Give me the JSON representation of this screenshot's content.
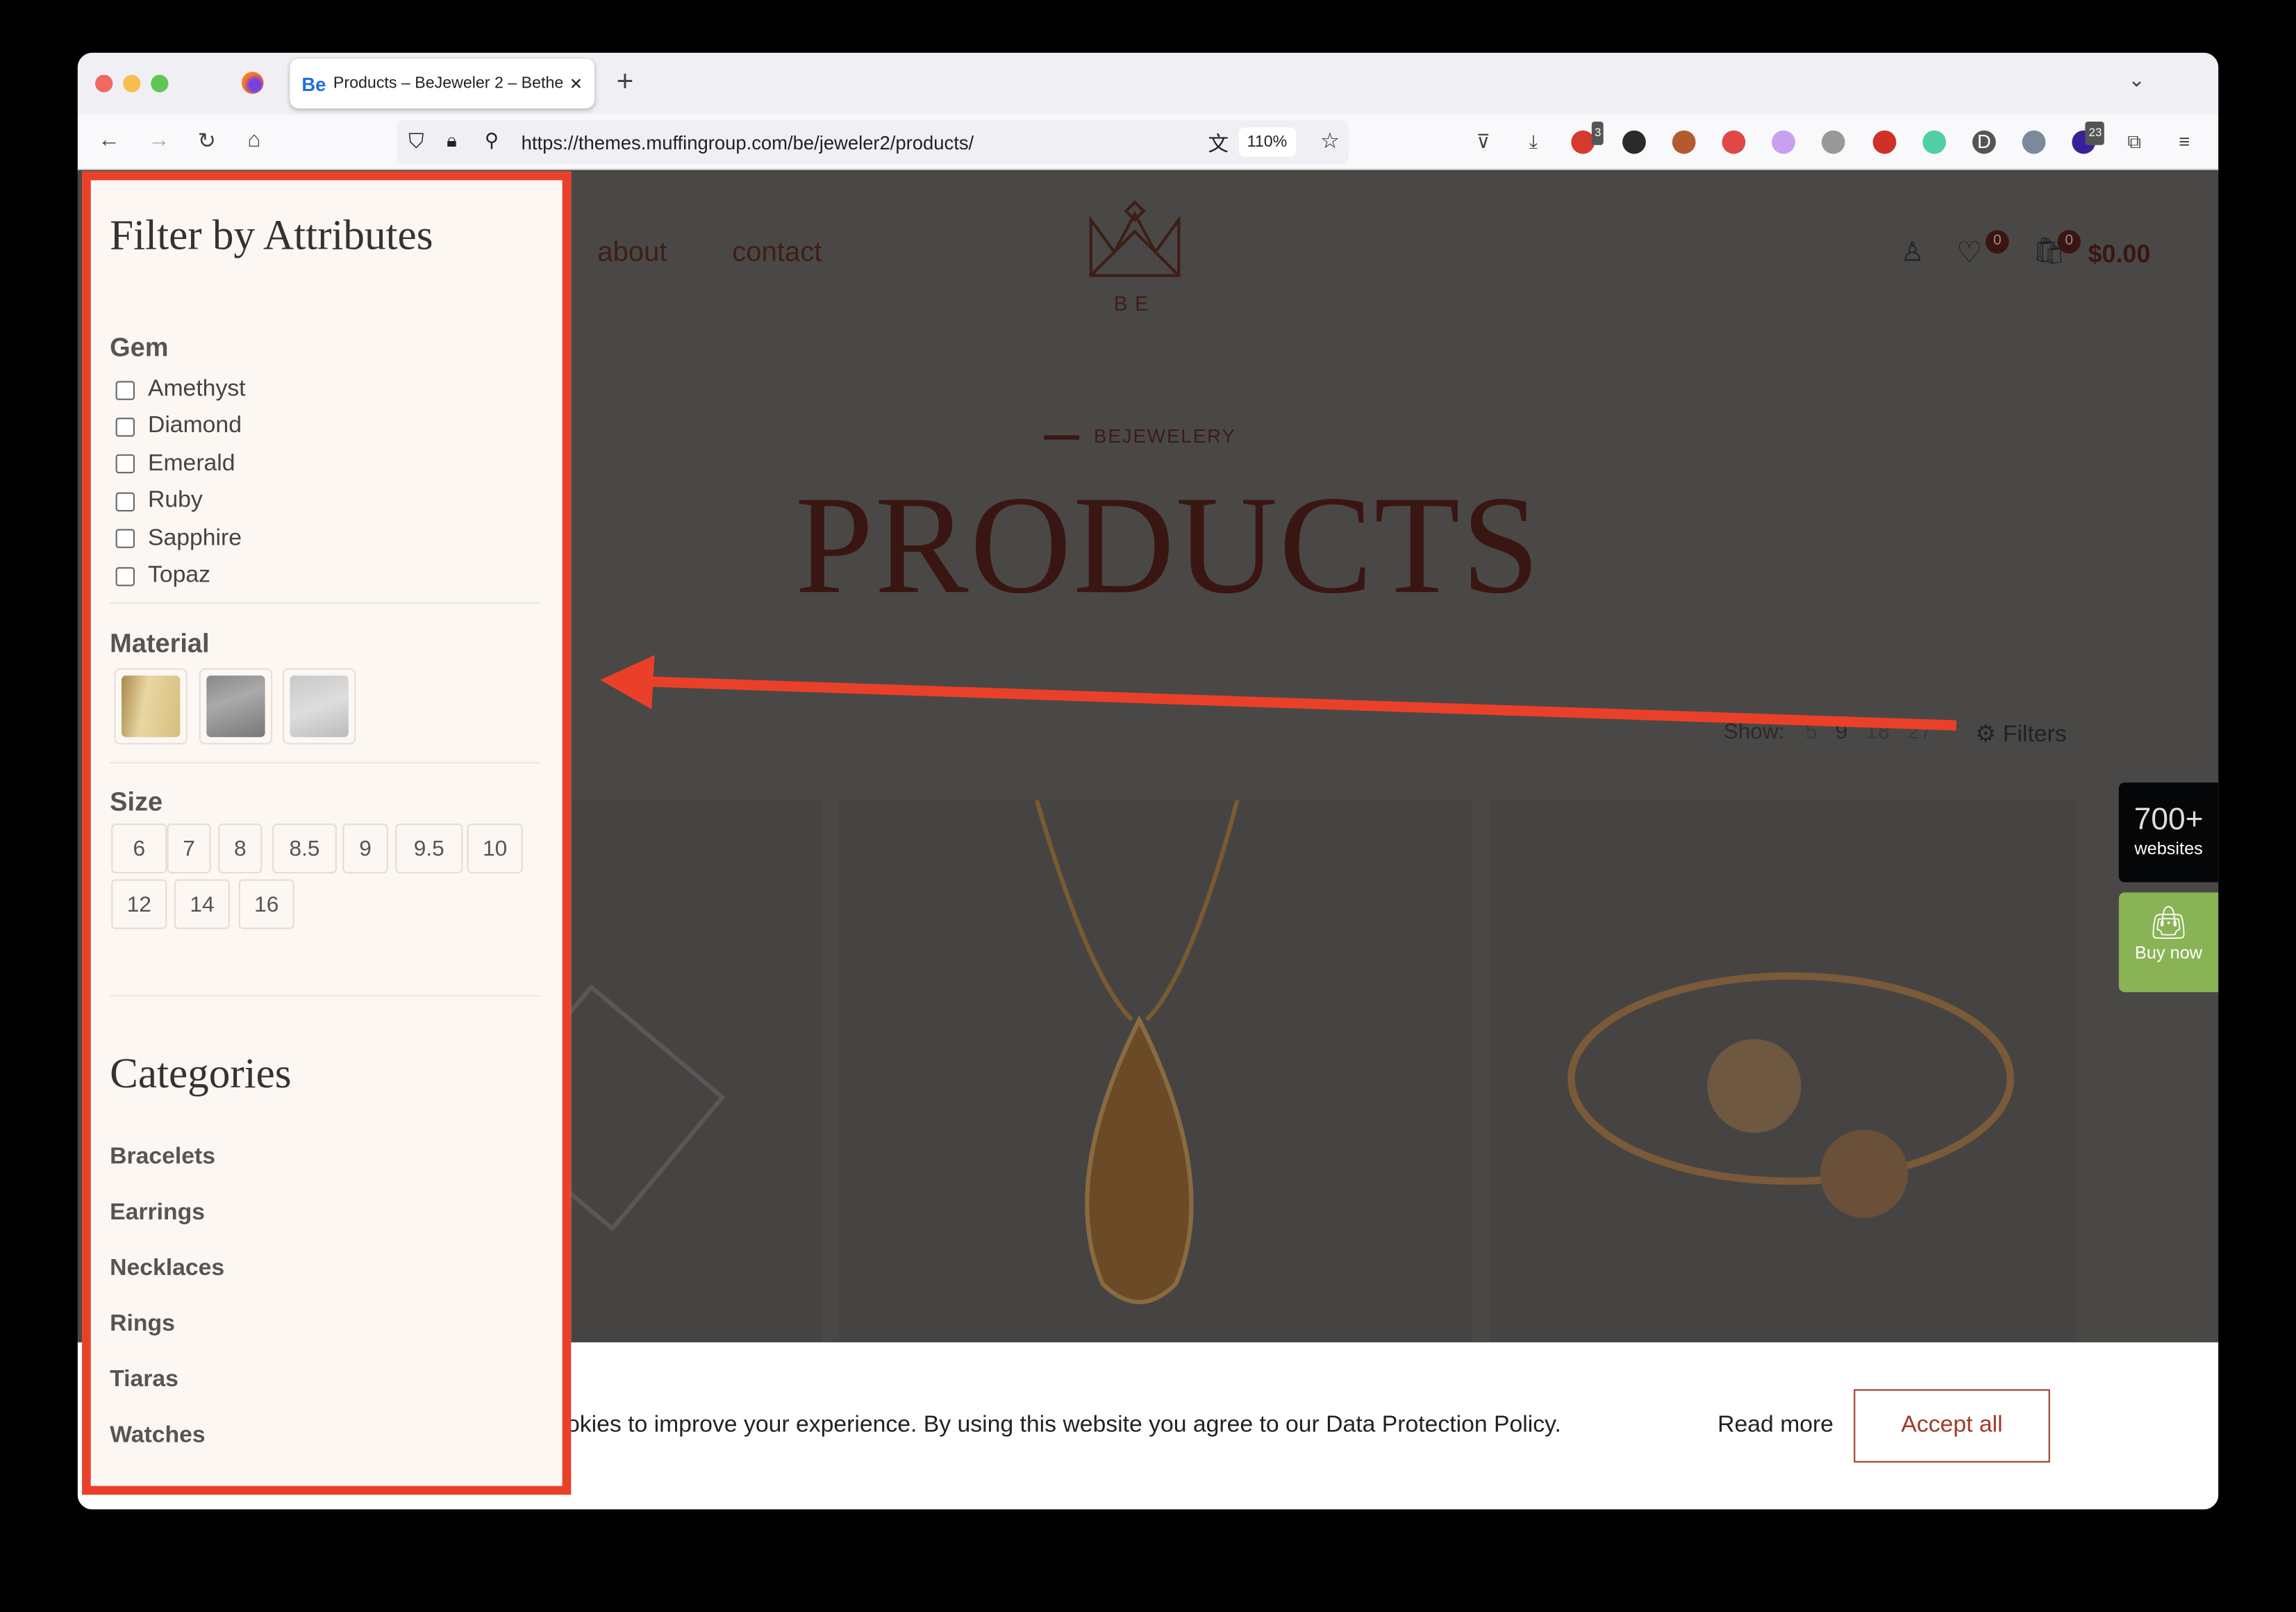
{
  "browser": {
    "tab_title": "Products – BeJeweler 2 – Betheme",
    "tab_favicon": "Be",
    "url": "https://themes.muffingroup.com/be/jeweler2/products/",
    "zoom": "110%",
    "extensions": [
      {
        "name": "pocket-icon"
      },
      {
        "name": "download-icon"
      },
      {
        "name": "lastpass-icon",
        "badge": "3"
      },
      {
        "name": "camera-icon"
      },
      {
        "name": "tools-icon"
      },
      {
        "name": "bird-icon"
      },
      {
        "name": "color-wheel-icon"
      },
      {
        "name": "gear-icon"
      },
      {
        "name": "pinterest-icon"
      },
      {
        "name": "runner-icon"
      },
      {
        "name": "d-icon"
      },
      {
        "name": "image-icon"
      },
      {
        "name": "stack-icon",
        "badge": "23"
      },
      {
        "name": "puzzle-icon"
      },
      {
        "name": "menu-icon"
      }
    ]
  },
  "site": {
    "menu": [
      "about",
      "contact"
    ],
    "logo_text": "BE",
    "wishlist_count": "0",
    "cart_count": "0",
    "cart_total": "$0.00",
    "pretitle": "BEJEWELERY",
    "title": "PRODUCTS",
    "show_label": "Show:",
    "show_options": [
      "5",
      "9",
      "18",
      "27"
    ],
    "filters_label": "Filters",
    "side_promo": {
      "big": "700+",
      "small": "websites"
    },
    "buy_now": "Buy now",
    "cookie_text": "okies to improve your experience. By using this website you agree to our Data Protection Policy.",
    "read_more": "Read more",
    "accept_all": "Accept all"
  },
  "panel": {
    "title": "Filter by Attributes",
    "gem_label": "Gem",
    "gems": [
      "Amethyst",
      "Diamond",
      "Emerald",
      "Ruby",
      "Sapphire",
      "Topaz"
    ],
    "material_label": "Material",
    "materials": [
      "gold",
      "dark-silver",
      "silver"
    ],
    "size_label": "Size",
    "sizes": [
      "6",
      "7",
      "8",
      "8.5",
      "9",
      "9.5",
      "10",
      "12",
      "14",
      "16"
    ],
    "categories_title": "Categories",
    "categories": [
      "Bracelets",
      "Earrings",
      "Necklaces",
      "Rings",
      "Tiaras",
      "Watches"
    ]
  },
  "colors": {
    "annotation": "#ea4029",
    "accent": "#a13a2a",
    "buy_now": "#8ab355"
  }
}
